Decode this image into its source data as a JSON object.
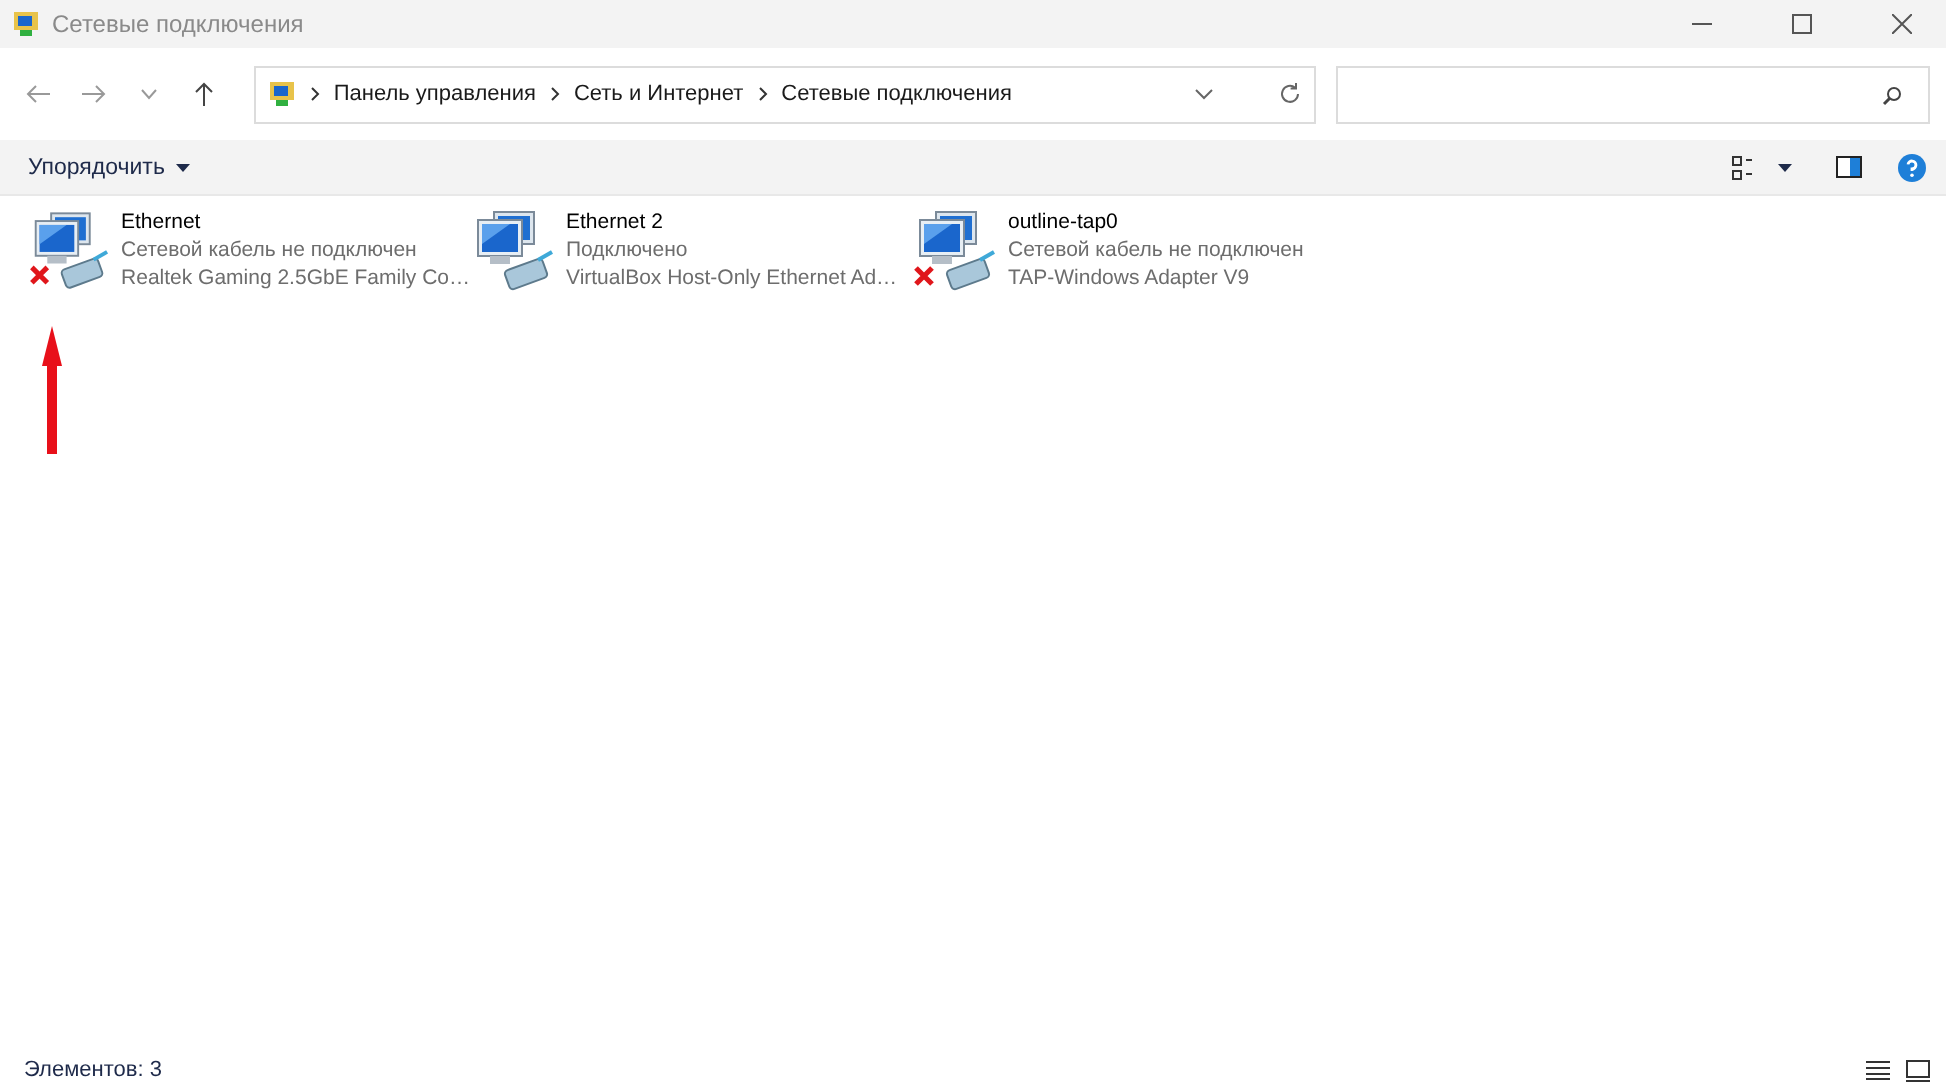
{
  "window": {
    "title": "Сетевые подключения"
  },
  "address_bar": {
    "breadcrumbs": [
      "Панель управления",
      "Сеть и Интернет",
      "Сетевые подключения"
    ]
  },
  "command_bar": {
    "organize": "Упорядочить"
  },
  "connections": [
    {
      "name": "Ethernet",
      "status": "Сетевой кабель не подключен",
      "adapter": "Realtek Gaming 2.5GbE Family Co…",
      "disconnected": true
    },
    {
      "name": "Ethernet 2",
      "status": "Подключено",
      "adapter": "VirtualBox Host-Only Ethernet Ad…",
      "disconnected": false
    },
    {
      "name": "outline-tap0",
      "status": "Сетевой кабель не подключен",
      "adapter": "TAP-Windows Adapter V9",
      "disconnected": true
    }
  ],
  "status_bar": {
    "count": "Элементов: 3"
  }
}
